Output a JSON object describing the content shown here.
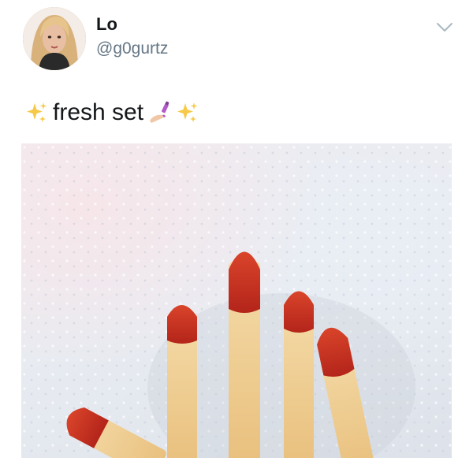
{
  "tweet": {
    "display_name": "Lo",
    "handle": "@g0gurtz",
    "text": "fresh set",
    "emoji_before": "sparkles",
    "emoji_after": [
      "nail-polish",
      "sparkles"
    ]
  },
  "media": {
    "description_icon": "photo",
    "subject": "fries-with-ketchup-tips-on-paper-towel"
  },
  "icons": {
    "menu": "chevron-down-icon",
    "avatar": "profile-photo"
  },
  "colors": {
    "name": "#14171a",
    "handle": "#657786",
    "chevron": "#aab8c2",
    "sparkle": "#f7c948",
    "nail_polish": "#b05bc8",
    "ketchup": "#c8341e",
    "fry": "#f1d49a"
  }
}
